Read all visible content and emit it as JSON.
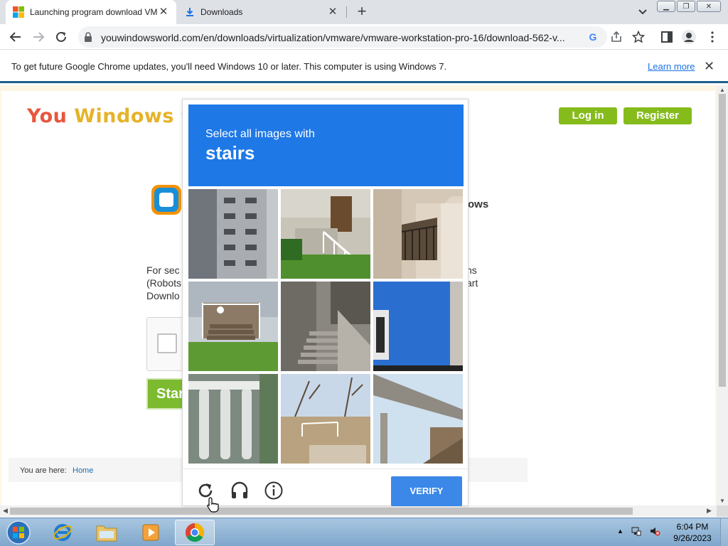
{
  "browser": {
    "tabs": [
      {
        "title": "Launching program download VM",
        "active": true
      },
      {
        "title": "Downloads",
        "active": false
      }
    ],
    "url": "youwindowsworld.com/en/downloads/virtualization/vmware/vmware-workstation-pro-16/download-562-v...",
    "infobar": {
      "message": "To get future Google Chrome updates, you'll need Windows 10 or later. This computer is using Windows 7.",
      "link": "Learn more"
    }
  },
  "site": {
    "logo_you": "You",
    "logo_windows": "Windows",
    "logo_partial": "W",
    "login": "Log in",
    "register": "Register",
    "title_partial": "ows",
    "body_left": [
      "For  sec",
      "(Robots",
      "Downlo"
    ],
    "body_right": [
      "ns",
      "art",
      ""
    ],
    "start_partial": "Star",
    "breadcrumb_label": "You are here:",
    "breadcrumb_home": "Home"
  },
  "challenge": {
    "prompt": "Select all images with",
    "target": "stairs",
    "verify": "VERIFY",
    "tiles": [
      "building-facade",
      "house-steps",
      "balcony-railing",
      "porch-stairs",
      "concrete-stairs",
      "blue-wall",
      "balusters",
      "park-steps",
      "bridge"
    ]
  },
  "taskbar": {
    "time": "6:04 PM",
    "date": "9/26/2023"
  },
  "colors": {
    "accent_blue": "#1e78e6",
    "verify_blue": "#3b88e8",
    "site_green": "#86bb1c"
  }
}
